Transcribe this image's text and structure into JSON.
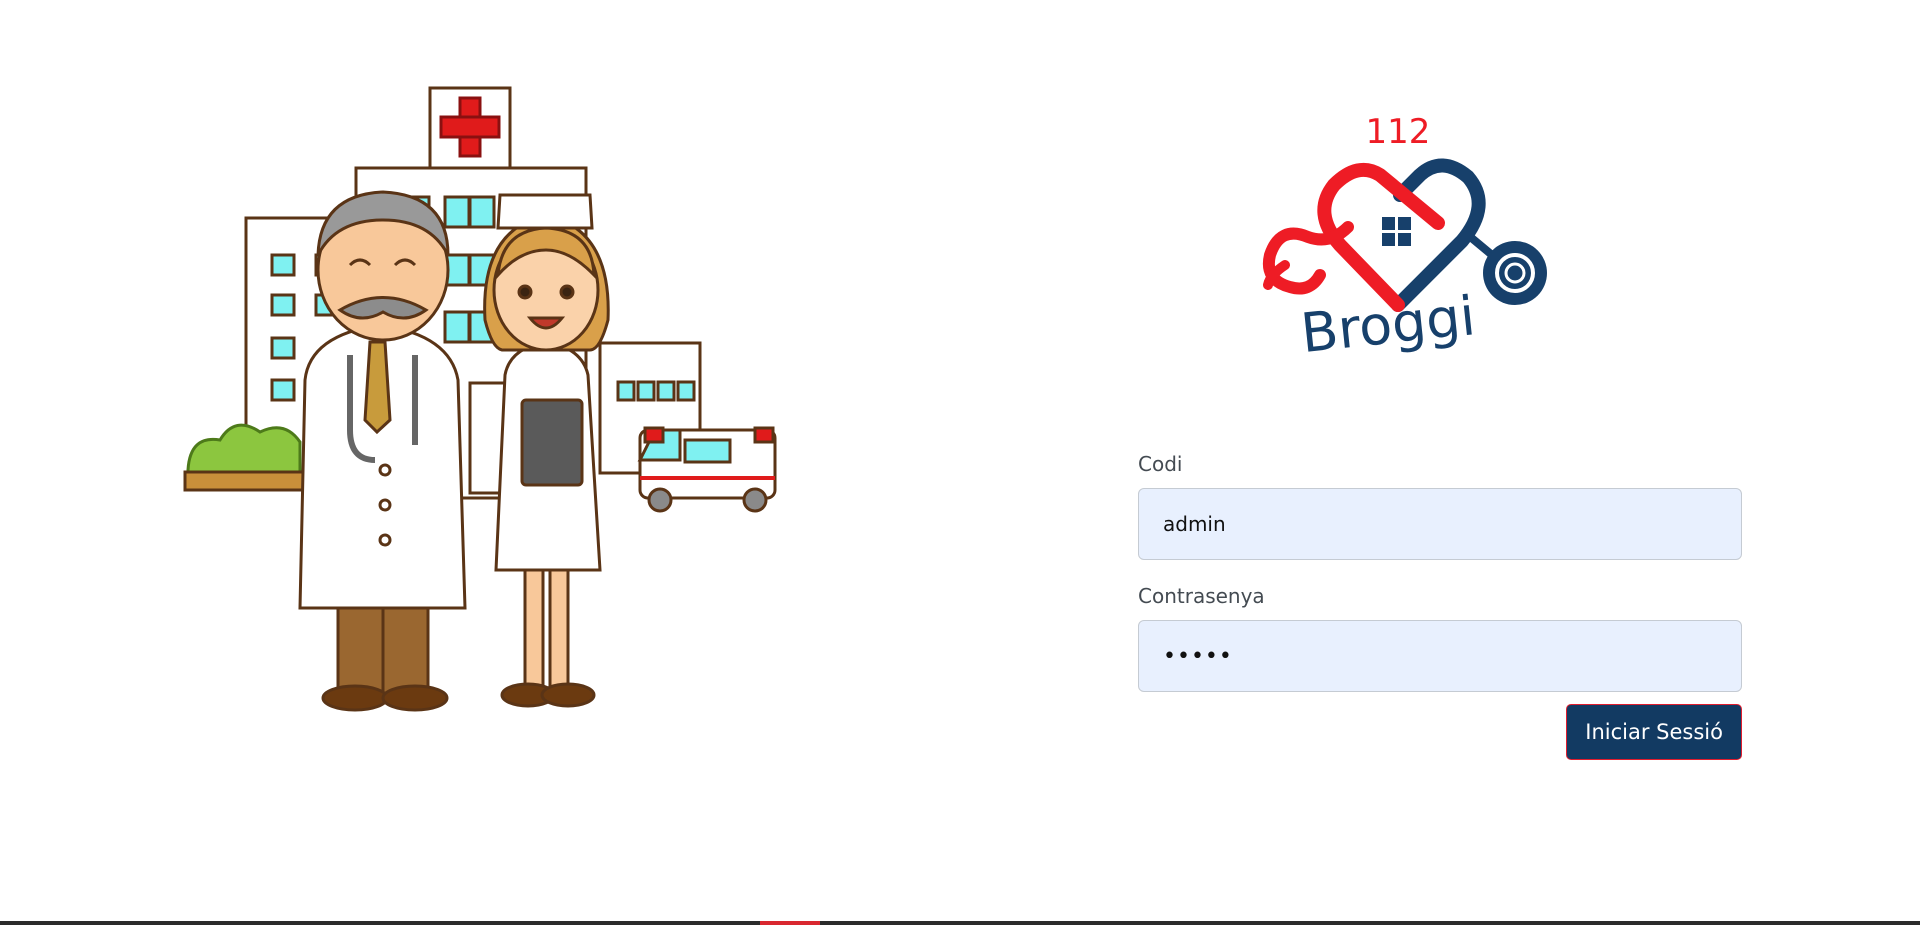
{
  "logo": {
    "number": "112",
    "brand": "Broggi",
    "colors": {
      "red": "#ee1c25",
      "navy": "#17406b"
    }
  },
  "illustration": {
    "description_icon": "hospital-doctor-nurse-ambulance-illustration"
  },
  "form": {
    "code_label": "Codi",
    "code_value": "admin",
    "password_label": "Contrasenya",
    "password_value": "•••••",
    "submit_label": "Iniciar Sessió"
  },
  "colors": {
    "input_background": "#e8f0fe",
    "button_background": "#123a62",
    "button_border": "#e11d2e"
  }
}
